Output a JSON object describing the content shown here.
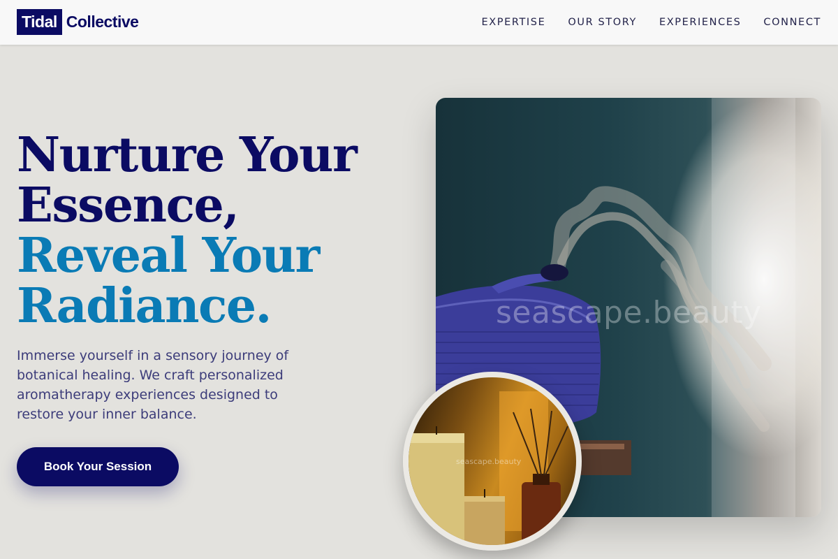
{
  "brand": {
    "logo_box": "Tidal",
    "logo_text": "Collective"
  },
  "nav": {
    "items": [
      "EXPERTISE",
      "OUR STORY",
      "EXPERIENCES",
      "CONNECT"
    ]
  },
  "hero": {
    "title_line1": "Nurture Your",
    "title_line2": "Essence,",
    "title_line3": "Reveal Your",
    "title_line4": "Radiance.",
    "description": "Immerse yourself in a sensory journey of botanical healing. We craft personalized aromatherapy experiences designed to restore your inner balance.",
    "cta_label": "Book Your Session"
  },
  "images": {
    "main_watermark": "seascape.beauty",
    "circle_watermark": "seascape.beauty"
  },
  "colors": {
    "primary_navy": "#0b0b63",
    "accent_blue": "#0a7bb5",
    "background": "#e3e2de",
    "header_bg": "#f8f8f8"
  }
}
